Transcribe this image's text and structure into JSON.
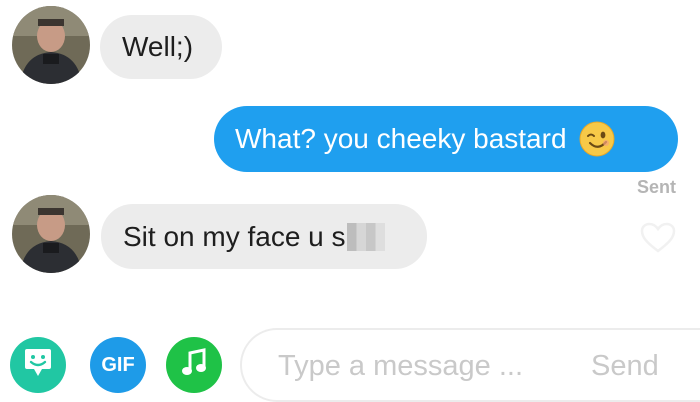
{
  "conversation": {
    "messages": [
      {
        "direction": "incoming",
        "text": "Well;)"
      },
      {
        "direction": "outgoing",
        "text": "What? you cheeky bastard",
        "emoji": "winking-face-icon",
        "status": "Sent"
      },
      {
        "direction": "incoming",
        "text": "Sit on my face u s"
      }
    ]
  },
  "composer": {
    "sticker_icon": "sticker-icon",
    "gif_label": "GIF",
    "music_icon": "music-note-icon",
    "placeholder": "Type a message ...",
    "send_label": "Send"
  },
  "colors": {
    "outgoing_bubble": "#1f9fef",
    "incoming_bubble": "#ececec",
    "sticker_button": "#21c7a3",
    "gif_button": "#1e9be8",
    "music_button": "#1fc247"
  }
}
